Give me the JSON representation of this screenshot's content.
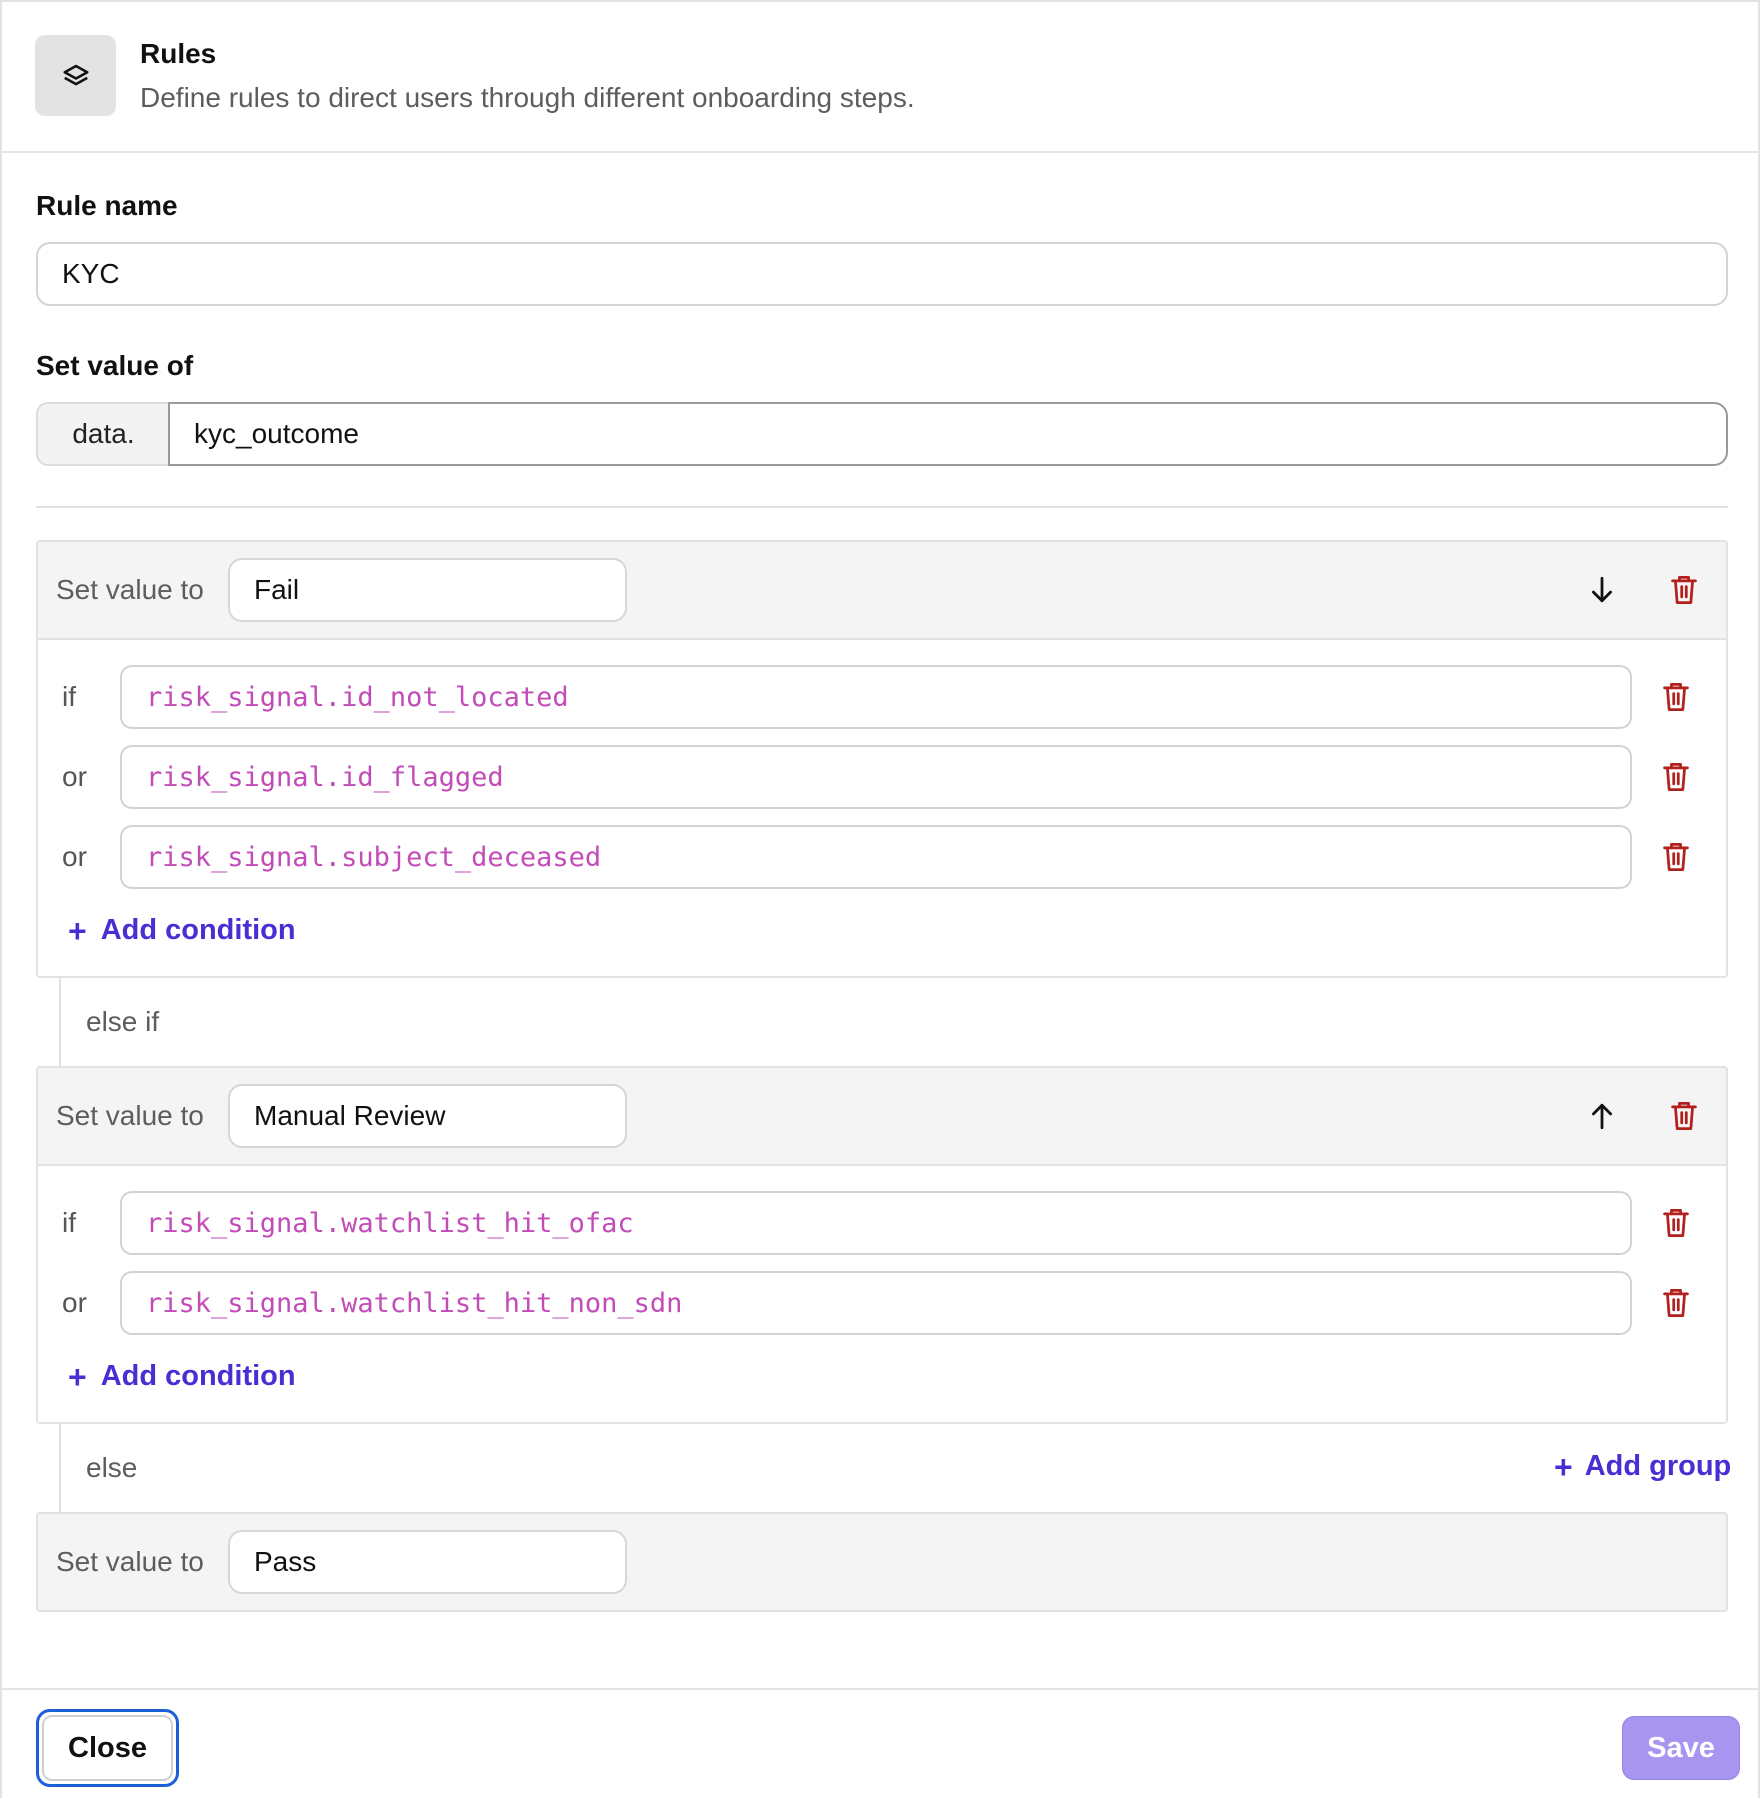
{
  "header": {
    "title": "Rules",
    "subtitle": "Define rules to direct users through different onboarding steps.",
    "icon": "layers-icon"
  },
  "form": {
    "rule_name_label": "Rule name",
    "rule_name_value": "KYC",
    "set_value_of_label": "Set value of",
    "prefix": "data.",
    "field_value": "kyc_outcome"
  },
  "groups": [
    {
      "set_label": "Set value to",
      "value": "Fail",
      "move_icon": "arrow-down-icon",
      "conditions": [
        {
          "op": "if",
          "expr": "risk_signal.id_not_located"
        },
        {
          "op": "or",
          "expr": "risk_signal.id_flagged"
        },
        {
          "op": "or",
          "expr": "risk_signal.subject_deceased"
        }
      ],
      "add_condition": "Add condition"
    },
    {
      "set_label": "Set value to",
      "value": "Manual Review",
      "move_icon": "arrow-up-icon",
      "conditions": [
        {
          "op": "if",
          "expr": "risk_signal.watchlist_hit_ofac"
        },
        {
          "op": "or",
          "expr": "risk_signal.watchlist_hit_non_sdn"
        }
      ],
      "add_condition": "Add condition"
    }
  ],
  "else_if_label": "else if",
  "else_label": "else",
  "add_group": "Add group",
  "else_group": {
    "set_label": "Set value to",
    "value": "Pass"
  },
  "footer": {
    "close_label": "Close",
    "save_label": "Save"
  },
  "colors": {
    "accent": "#4a2ed4",
    "danger": "#b3201c",
    "code": "#c24cb8",
    "save_disabled": "#a895f0",
    "focus_ring": "#1a5fd6"
  }
}
